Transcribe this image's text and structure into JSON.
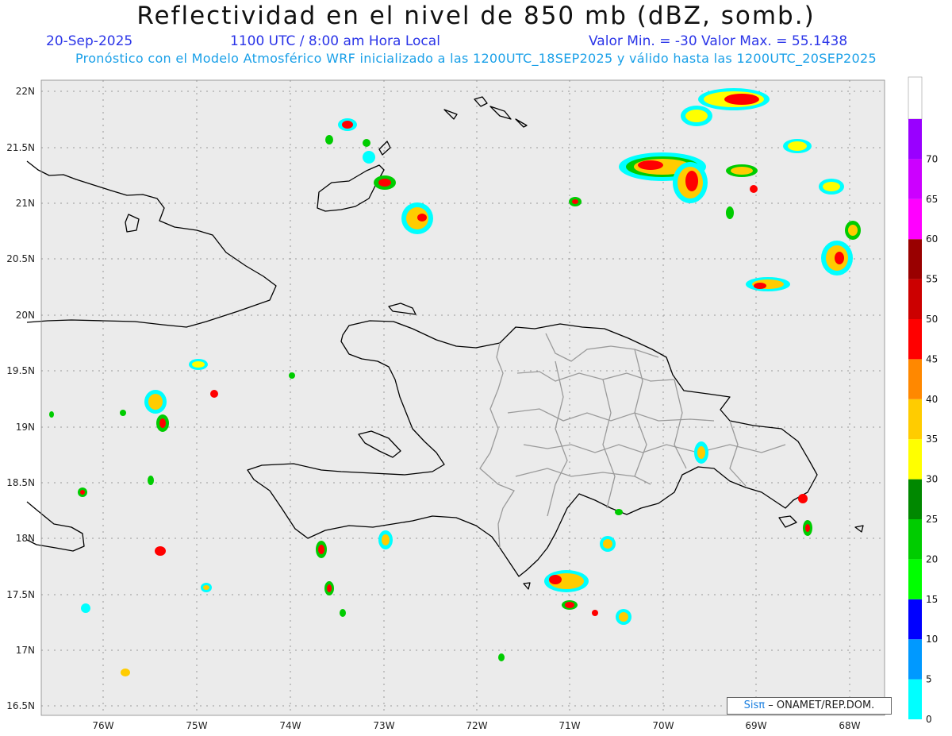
{
  "header": {
    "title": "Reflectividad en el nivel de 850 mb (dBZ, somb.)",
    "date": "20-Sep-2025",
    "time": "1100 UTC / 8:00 am Hora Local",
    "minmax": "Valor Min. = -30  Valor Max. = 55.1438",
    "subtitle": "Pronóstico con el Modelo Atmosférico WRF inicializado a las 1200UTC_18SEP2025 y válido hasta las  1200UTC_20SEP2025"
  },
  "map": {
    "lat_labels": [
      "22N",
      "21.5N",
      "21N",
      "20.5N",
      "20N",
      "19.5N",
      "19N",
      "18.5N",
      "18N",
      "17.5N",
      "17N",
      "16.5N"
    ],
    "lon_labels": [
      "76W",
      "75W",
      "74W",
      "73W",
      "72W",
      "71W",
      "70W",
      "69W",
      "68W"
    ],
    "background_color": "#ebebeb",
    "coast_color": "#000000",
    "province_color": "#9a9a9a"
  },
  "colorbar": {
    "labels": [
      "0",
      "5",
      "10",
      "15",
      "20",
      "25",
      "30",
      "35",
      "40",
      "45",
      "50",
      "55",
      "60",
      "65",
      "70"
    ],
    "colors": [
      "#00ffff",
      "#0099ff",
      "#0000ff",
      "#00ff00",
      "#00cc00",
      "#008800",
      "#ffff00",
      "#ffcc00",
      "#ff8800",
      "#ff0000",
      "#cc0000",
      "#990000",
      "#ff00ff",
      "#cc00ff",
      "#9900ff"
    ]
  },
  "credit": {
    "logo": "Sisπ",
    "text": "– ONAMET/REP.DOM."
  }
}
